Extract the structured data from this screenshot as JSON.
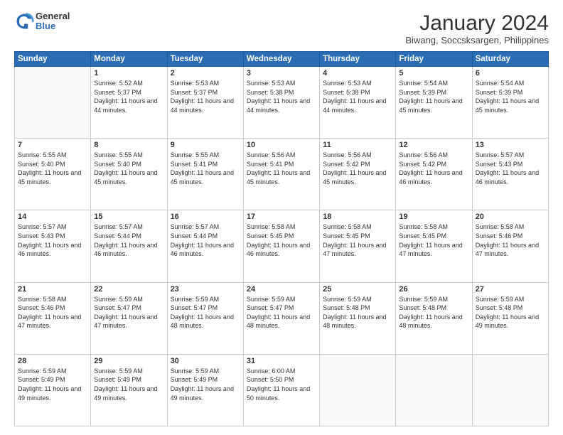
{
  "header": {
    "logo_general": "General",
    "logo_blue": "Blue",
    "main_title": "January 2024",
    "subtitle": "Biwang, Soccsksargen, Philippines"
  },
  "days_of_week": [
    "Sunday",
    "Monday",
    "Tuesday",
    "Wednesday",
    "Thursday",
    "Friday",
    "Saturday"
  ],
  "weeks": [
    [
      {
        "day": "",
        "sunrise": "",
        "sunset": "",
        "daylight": ""
      },
      {
        "day": "1",
        "sunrise": "Sunrise: 5:52 AM",
        "sunset": "Sunset: 5:37 PM",
        "daylight": "Daylight: 11 hours and 44 minutes."
      },
      {
        "day": "2",
        "sunrise": "Sunrise: 5:53 AM",
        "sunset": "Sunset: 5:37 PM",
        "daylight": "Daylight: 11 hours and 44 minutes."
      },
      {
        "day": "3",
        "sunrise": "Sunrise: 5:53 AM",
        "sunset": "Sunset: 5:38 PM",
        "daylight": "Daylight: 11 hours and 44 minutes."
      },
      {
        "day": "4",
        "sunrise": "Sunrise: 5:53 AM",
        "sunset": "Sunset: 5:38 PM",
        "daylight": "Daylight: 11 hours and 44 minutes."
      },
      {
        "day": "5",
        "sunrise": "Sunrise: 5:54 AM",
        "sunset": "Sunset: 5:39 PM",
        "daylight": "Daylight: 11 hours and 45 minutes."
      },
      {
        "day": "6",
        "sunrise": "Sunrise: 5:54 AM",
        "sunset": "Sunset: 5:39 PM",
        "daylight": "Daylight: 11 hours and 45 minutes."
      }
    ],
    [
      {
        "day": "7",
        "sunrise": "Sunrise: 5:55 AM",
        "sunset": "Sunset: 5:40 PM",
        "daylight": "Daylight: 11 hours and 45 minutes."
      },
      {
        "day": "8",
        "sunrise": "Sunrise: 5:55 AM",
        "sunset": "Sunset: 5:40 PM",
        "daylight": "Daylight: 11 hours and 45 minutes."
      },
      {
        "day": "9",
        "sunrise": "Sunrise: 5:55 AM",
        "sunset": "Sunset: 5:41 PM",
        "daylight": "Daylight: 11 hours and 45 minutes."
      },
      {
        "day": "10",
        "sunrise": "Sunrise: 5:56 AM",
        "sunset": "Sunset: 5:41 PM",
        "daylight": "Daylight: 11 hours and 45 minutes."
      },
      {
        "day": "11",
        "sunrise": "Sunrise: 5:56 AM",
        "sunset": "Sunset: 5:42 PM",
        "daylight": "Daylight: 11 hours and 45 minutes."
      },
      {
        "day": "12",
        "sunrise": "Sunrise: 5:56 AM",
        "sunset": "Sunset: 5:42 PM",
        "daylight": "Daylight: 11 hours and 46 minutes."
      },
      {
        "day": "13",
        "sunrise": "Sunrise: 5:57 AM",
        "sunset": "Sunset: 5:43 PM",
        "daylight": "Daylight: 11 hours and 46 minutes."
      }
    ],
    [
      {
        "day": "14",
        "sunrise": "Sunrise: 5:57 AM",
        "sunset": "Sunset: 5:43 PM",
        "daylight": "Daylight: 11 hours and 46 minutes."
      },
      {
        "day": "15",
        "sunrise": "Sunrise: 5:57 AM",
        "sunset": "Sunset: 5:44 PM",
        "daylight": "Daylight: 11 hours and 46 minutes."
      },
      {
        "day": "16",
        "sunrise": "Sunrise: 5:57 AM",
        "sunset": "Sunset: 5:44 PM",
        "daylight": "Daylight: 11 hours and 46 minutes."
      },
      {
        "day": "17",
        "sunrise": "Sunrise: 5:58 AM",
        "sunset": "Sunset: 5:45 PM",
        "daylight": "Daylight: 11 hours and 46 minutes."
      },
      {
        "day": "18",
        "sunrise": "Sunrise: 5:58 AM",
        "sunset": "Sunset: 5:45 PM",
        "daylight": "Daylight: 11 hours and 47 minutes."
      },
      {
        "day": "19",
        "sunrise": "Sunrise: 5:58 AM",
        "sunset": "Sunset: 5:45 PM",
        "daylight": "Daylight: 11 hours and 47 minutes."
      },
      {
        "day": "20",
        "sunrise": "Sunrise: 5:58 AM",
        "sunset": "Sunset: 5:46 PM",
        "daylight": "Daylight: 11 hours and 47 minutes."
      }
    ],
    [
      {
        "day": "21",
        "sunrise": "Sunrise: 5:58 AM",
        "sunset": "Sunset: 5:46 PM",
        "daylight": "Daylight: 11 hours and 47 minutes."
      },
      {
        "day": "22",
        "sunrise": "Sunrise: 5:59 AM",
        "sunset": "Sunset: 5:47 PM",
        "daylight": "Daylight: 11 hours and 47 minutes."
      },
      {
        "day": "23",
        "sunrise": "Sunrise: 5:59 AM",
        "sunset": "Sunset: 5:47 PM",
        "daylight": "Daylight: 11 hours and 48 minutes."
      },
      {
        "day": "24",
        "sunrise": "Sunrise: 5:59 AM",
        "sunset": "Sunset: 5:47 PM",
        "daylight": "Daylight: 11 hours and 48 minutes."
      },
      {
        "day": "25",
        "sunrise": "Sunrise: 5:59 AM",
        "sunset": "Sunset: 5:48 PM",
        "daylight": "Daylight: 11 hours and 48 minutes."
      },
      {
        "day": "26",
        "sunrise": "Sunrise: 5:59 AM",
        "sunset": "Sunset: 5:48 PM",
        "daylight": "Daylight: 11 hours and 48 minutes."
      },
      {
        "day": "27",
        "sunrise": "Sunrise: 5:59 AM",
        "sunset": "Sunset: 5:48 PM",
        "daylight": "Daylight: 11 hours and 49 minutes."
      }
    ],
    [
      {
        "day": "28",
        "sunrise": "Sunrise: 5:59 AM",
        "sunset": "Sunset: 5:49 PM",
        "daylight": "Daylight: 11 hours and 49 minutes."
      },
      {
        "day": "29",
        "sunrise": "Sunrise: 5:59 AM",
        "sunset": "Sunset: 5:49 PM",
        "daylight": "Daylight: 11 hours and 49 minutes."
      },
      {
        "day": "30",
        "sunrise": "Sunrise: 5:59 AM",
        "sunset": "Sunset: 5:49 PM",
        "daylight": "Daylight: 11 hours and 49 minutes."
      },
      {
        "day": "31",
        "sunrise": "Sunrise: 6:00 AM",
        "sunset": "Sunset: 5:50 PM",
        "daylight": "Daylight: 11 hours and 50 minutes."
      },
      {
        "day": "",
        "sunrise": "",
        "sunset": "",
        "daylight": ""
      },
      {
        "day": "",
        "sunrise": "",
        "sunset": "",
        "daylight": ""
      },
      {
        "day": "",
        "sunrise": "",
        "sunset": "",
        "daylight": ""
      }
    ]
  ]
}
